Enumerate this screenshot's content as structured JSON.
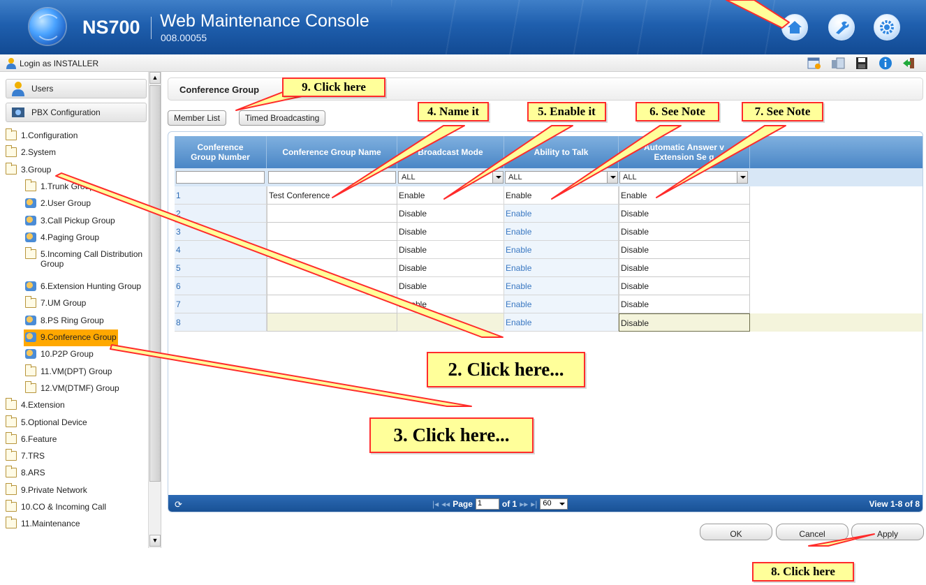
{
  "header": {
    "product": "NS700",
    "title": "Web Maintenance Console",
    "version": "008.00055",
    "buttons": [
      "home-icon",
      "tools-icon",
      "gear-icon"
    ]
  },
  "login": {
    "text": "Login as INSTALLER",
    "toolbar_icons": [
      "calendar-warning-icon",
      "phone-list-icon",
      "save-icon",
      "info-icon",
      "logout-icon"
    ]
  },
  "sidebar": {
    "panel_users": "Users",
    "panel_pbx": "PBX Configuration",
    "tree": [
      {
        "label": "1.Configuration",
        "level": 0,
        "icon": "folder-icon"
      },
      {
        "label": "2.System",
        "level": 0,
        "icon": "folder-icon"
      },
      {
        "label": "3.Group",
        "level": 0,
        "icon": "folder-open-icon"
      },
      {
        "label": "1.Trunk Group",
        "level": 1,
        "icon": "folder-icon"
      },
      {
        "label": "2.User Group",
        "level": 1,
        "icon": "user-group-icon"
      },
      {
        "label": "3.Call Pickup Group",
        "level": 1,
        "icon": "call-pickup-icon"
      },
      {
        "label": "4.Paging Group",
        "level": 1,
        "icon": "paging-icon"
      },
      {
        "label": "5.Incoming Call Distribution",
        "label2": "Group",
        "level": 1,
        "icon": "folder-icon"
      },
      {
        "label": "6.Extension Hunting Group",
        "level": 1,
        "icon": "hunting-icon"
      },
      {
        "label": "7.UM Group",
        "level": 1,
        "icon": "folder-icon"
      },
      {
        "label": "8.PS Ring Group",
        "level": 1,
        "icon": "ps-ring-icon"
      },
      {
        "label": "9.Conference Group",
        "level": 1,
        "icon": "conference-icon",
        "selected": true
      },
      {
        "label": "10.P2P Group",
        "level": 1,
        "icon": "p2p-icon"
      },
      {
        "label": "11.VM(DPT) Group",
        "level": 1,
        "icon": "folder-icon"
      },
      {
        "label": "12.VM(DTMF) Group",
        "level": 1,
        "icon": "folder-icon"
      },
      {
        "label": "4.Extension",
        "level": 0,
        "icon": "folder-icon"
      },
      {
        "label": "5.Optional Device",
        "level": 0,
        "icon": "folder-icon"
      },
      {
        "label": "6.Feature",
        "level": 0,
        "icon": "folder-icon"
      },
      {
        "label": "7.TRS",
        "level": 0,
        "icon": "folder-icon"
      },
      {
        "label": "8.ARS",
        "level": 0,
        "icon": "folder-icon"
      },
      {
        "label": "9.Private Network",
        "level": 0,
        "icon": "folder-icon"
      },
      {
        "label": "10.CO & Incoming Call",
        "level": 0,
        "icon": "folder-icon"
      },
      {
        "label": "11.Maintenance",
        "level": 0,
        "icon": "folder-icon"
      }
    ]
  },
  "main": {
    "title": "Conference Group",
    "tabs": [
      "Member List",
      "Timed Broadcasting"
    ],
    "columns": [
      {
        "l1": "Conference",
        "l2": "Group Number"
      },
      {
        "l1": "Conference Group Name",
        "l2": ""
      },
      {
        "l1": "Broadcast Mode",
        "l2": ""
      },
      {
        "l1": "Ability to Talk",
        "l2": ""
      },
      {
        "l1": "Automatic Answer v",
        "l2": "Extension Se  g"
      }
    ],
    "filters": [
      "",
      "",
      "ALL",
      "ALL",
      "ALL"
    ],
    "rows": [
      [
        "1",
        "Test Conference",
        "Enable",
        "Enable",
        "Enable"
      ],
      [
        "2",
        "",
        "Disable",
        "Enable",
        "Disable"
      ],
      [
        "3",
        "",
        "Disable",
        "Enable",
        "Disable"
      ],
      [
        "4",
        "",
        "Disable",
        "Enable",
        "Disable"
      ],
      [
        "5",
        "",
        "Disable",
        "Enable",
        "Disable"
      ],
      [
        "6",
        "",
        "Disable",
        "Enable",
        "Disable"
      ],
      [
        "7",
        "",
        "Disable",
        "Enable",
        "Disable"
      ],
      [
        "8",
        "",
        "",
        "Enable",
        "Disable"
      ]
    ],
    "pager": {
      "page_label": "Page",
      "page_value": "1",
      "of_label": "of 1",
      "per_page": "60",
      "view": "View 1-8 of 8"
    },
    "actions": {
      "ok": "OK",
      "cancel": "Cancel",
      "apply": "Apply"
    }
  },
  "annotations": {
    "a9": "9. Click here",
    "a4": "4. Name it",
    "a5": "5. Enable it",
    "a6": "6. See Note",
    "a7": "7. See Note",
    "a2": "2. Click here...",
    "a3": "3. Click here...",
    "a8": "8. Click here"
  },
  "colors": {
    "header": "#1f5fae",
    "selected": "#ffa800",
    "grid_header": "#4a86c6",
    "callout_fill": "#ffff9a",
    "callout_border": "#ff2b2b"
  }
}
